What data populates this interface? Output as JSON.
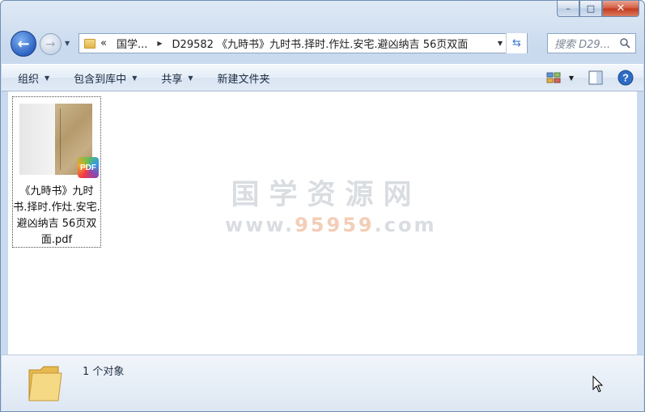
{
  "window": {
    "minimize_label": "–",
    "maximize_label": "□",
    "close_label": "✕"
  },
  "nav": {
    "back_icon": "←",
    "forward_icon": "→",
    "dropdown_icon": "▼"
  },
  "address": {
    "prefix": "«",
    "segments": [
      "国学...",
      "D29582 《九時书》九时书.择时.作灶.安宅.避凶纳吉 56页双面"
    ],
    "refresh_icon": "⇆"
  },
  "search": {
    "placeholder": "搜索 D29..."
  },
  "toolbar": {
    "organize": "组织",
    "include_library": "包含到库中",
    "share": "共享",
    "new_folder": "新建文件夹"
  },
  "file": {
    "badge": "PDF",
    "name": "《九時书》九时书.择时.作灶.安宅.避凶纳吉 56页双面.pdf"
  },
  "watermark": {
    "title": "国学资源网",
    "url_prefix": "www.",
    "url_accent": "95959",
    "url_suffix": ".com"
  },
  "status": {
    "count_text": "1 个对象"
  },
  "colors": {
    "accent": "#2c63c4",
    "close_button": "#c3391f",
    "watermark": "#d9dde1"
  }
}
